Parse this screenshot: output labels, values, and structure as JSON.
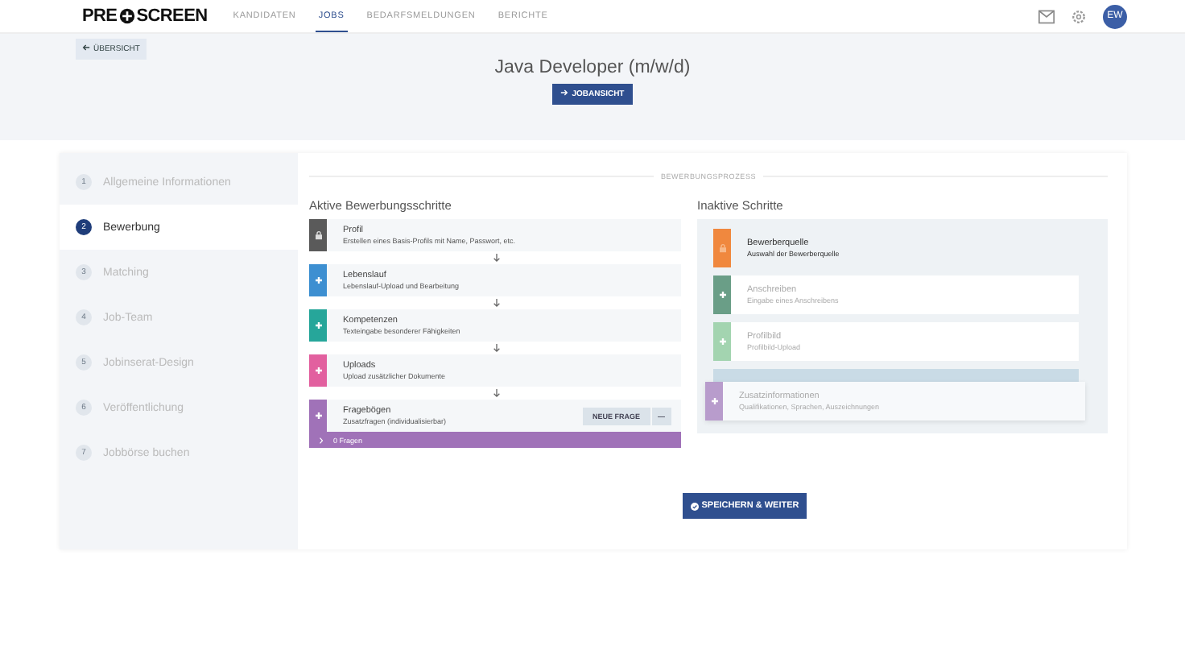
{
  "header": {
    "logo": [
      "PRE",
      "SCREEN"
    ],
    "nav": [
      {
        "label": "KANDIDATEN",
        "selected": false
      },
      {
        "label": "JOBS",
        "selected": true
      },
      {
        "label": "BEDARFSMELDUNGEN",
        "selected": false
      },
      {
        "label": "BERICHTE",
        "selected": false
      }
    ],
    "avatar": "EW"
  },
  "back_button": "ÜBERSICHT",
  "job_title": "Java Developer (m/w/d)",
  "job_button": "JOBANSICHT",
  "steps": [
    {
      "number": "1",
      "label": "Allgemeine Informationen",
      "selected": false
    },
    {
      "number": "2",
      "label": "Bewerbung",
      "selected": true
    },
    {
      "number": "3",
      "label": "Matching",
      "selected": false
    },
    {
      "number": "4",
      "label": "Job-Team",
      "selected": false
    },
    {
      "number": "5",
      "label": "Jobinserat-Design",
      "selected": false
    },
    {
      "number": "6",
      "label": "Veröffentlichung",
      "selected": false
    },
    {
      "number": "7",
      "label": "Jobbörse buchen",
      "selected": false
    }
  ],
  "section_label": "BEWERBUNGSPROZESS",
  "active": {
    "title": "Aktive Bewerbungsschritte",
    "items": [
      {
        "title": "Profil",
        "subtitle": "Erstellen eines Basis-Profils mit Name, Passwort, etc.",
        "color": "#5a5a5a",
        "locked": true
      },
      {
        "title": "Lebenslauf",
        "subtitle": "Lebenslauf-Upload und Bearbeitung",
        "color": "#3d8fd1",
        "locked": false
      },
      {
        "title": "Kompetenzen",
        "subtitle": "Texteingabe besonderer Fähigkeiten",
        "color": "#26a69a",
        "locked": false
      },
      {
        "title": "Uploads",
        "subtitle": "Upload zusätzlicher Dokumente",
        "color": "#e2609f",
        "locked": false
      },
      {
        "title": "Fragebögen",
        "subtitle": "Zusatzfragen (individualisierbar)",
        "color": "#a072b8",
        "locked": false,
        "button": "NEUE FRAGE",
        "button_extra": "—",
        "footer": "0 Fragen"
      }
    ]
  },
  "inactive": {
    "title": "Inaktive Schritte",
    "items": [
      {
        "title": "Bewerberquelle",
        "subtitle": "Auswahl der Bewerberquelle",
        "color": "#f0883e",
        "locked": true,
        "dragging": false
      },
      {
        "title": "Anschreiben",
        "subtitle": "Eingabe eines Anschreibens",
        "color": "#6a9e87",
        "locked": false,
        "dragging": false
      },
      {
        "title": "Profilbild",
        "subtitle": "Profilbild-Upload",
        "color": "#a3d4b0",
        "locked": false,
        "dragging": false
      },
      {
        "title": "Zusatzinformationen",
        "subtitle": "Qualifikationen, Sprachen, Auszeichnungen",
        "color": "#b89ccc",
        "locked": false,
        "dragging": true
      }
    ]
  },
  "save_button": "SPEICHERN & WEITER"
}
